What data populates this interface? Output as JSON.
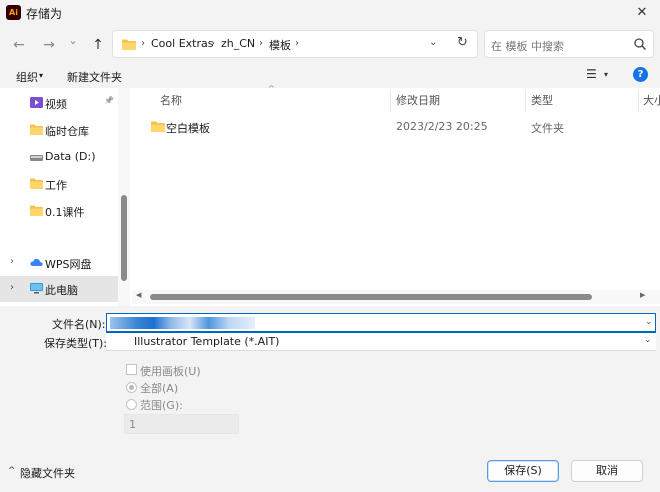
{
  "window": {
    "app_icon_text": "Ai",
    "title": "存储为",
    "close_glyph": "✕"
  },
  "nav": {
    "back_glyph": "←",
    "forward_glyph": "→",
    "recent_glyph": "⌄",
    "up_glyph": "↑",
    "breadcrumbs": [
      "Cool Extras",
      "zh_CN",
      "模板"
    ],
    "separator": "›",
    "dropdown_glyph": "⌄",
    "refresh_glyph": "↻",
    "search_placeholder": "在 模板 中搜索"
  },
  "toolbar": {
    "organize_label": "组织",
    "organize_dd": "▾",
    "new_folder_label": "新建文件夹",
    "view_glyph": "☰",
    "view_dd": "▾",
    "help_label": "?"
  },
  "sidebar": {
    "items": [
      {
        "label": "视频",
        "icon": "video-folder-icon",
        "pinned": true
      },
      {
        "label": "临时仓库",
        "icon": "folder-icon"
      },
      {
        "label": "Data (D:)",
        "icon": "drive-icon"
      },
      {
        "label": "工作",
        "icon": "folder-icon"
      },
      {
        "label": "0.1课件",
        "icon": "folder-icon"
      },
      {
        "label": "WPS网盘",
        "icon": "cloud-icon"
      },
      {
        "label": "此电脑",
        "icon": "computer-icon"
      }
    ],
    "pin_glyph": "📌",
    "chevron_glyph": "›"
  },
  "file_list": {
    "columns": [
      "名称",
      "修改日期",
      "类型",
      "大小"
    ],
    "sort_glyph": "^",
    "rows": [
      {
        "name": "空白模板",
        "modified": "2023/2/23 20:25",
        "type": "文件夹"
      }
    ]
  },
  "form": {
    "filename_label": "文件名(N):",
    "filetype_label": "保存类型(T):",
    "filetype_value": "Illustrator Template (*.AIT)",
    "dropdown_glyph": "⌄"
  },
  "options": {
    "use_artboards_label": "使用画板(U)",
    "all_label": "全部(A)",
    "range_label": "范围(G):",
    "range_value": "1"
  },
  "footer": {
    "hide_folders_label": "隐藏文件夹",
    "hide_chev": "^",
    "save_label": "保存(S)",
    "cancel_label": "取消"
  },
  "colors": {
    "accent": "#0067c0",
    "folder": "#f4c04e",
    "help": "#1473e6"
  }
}
